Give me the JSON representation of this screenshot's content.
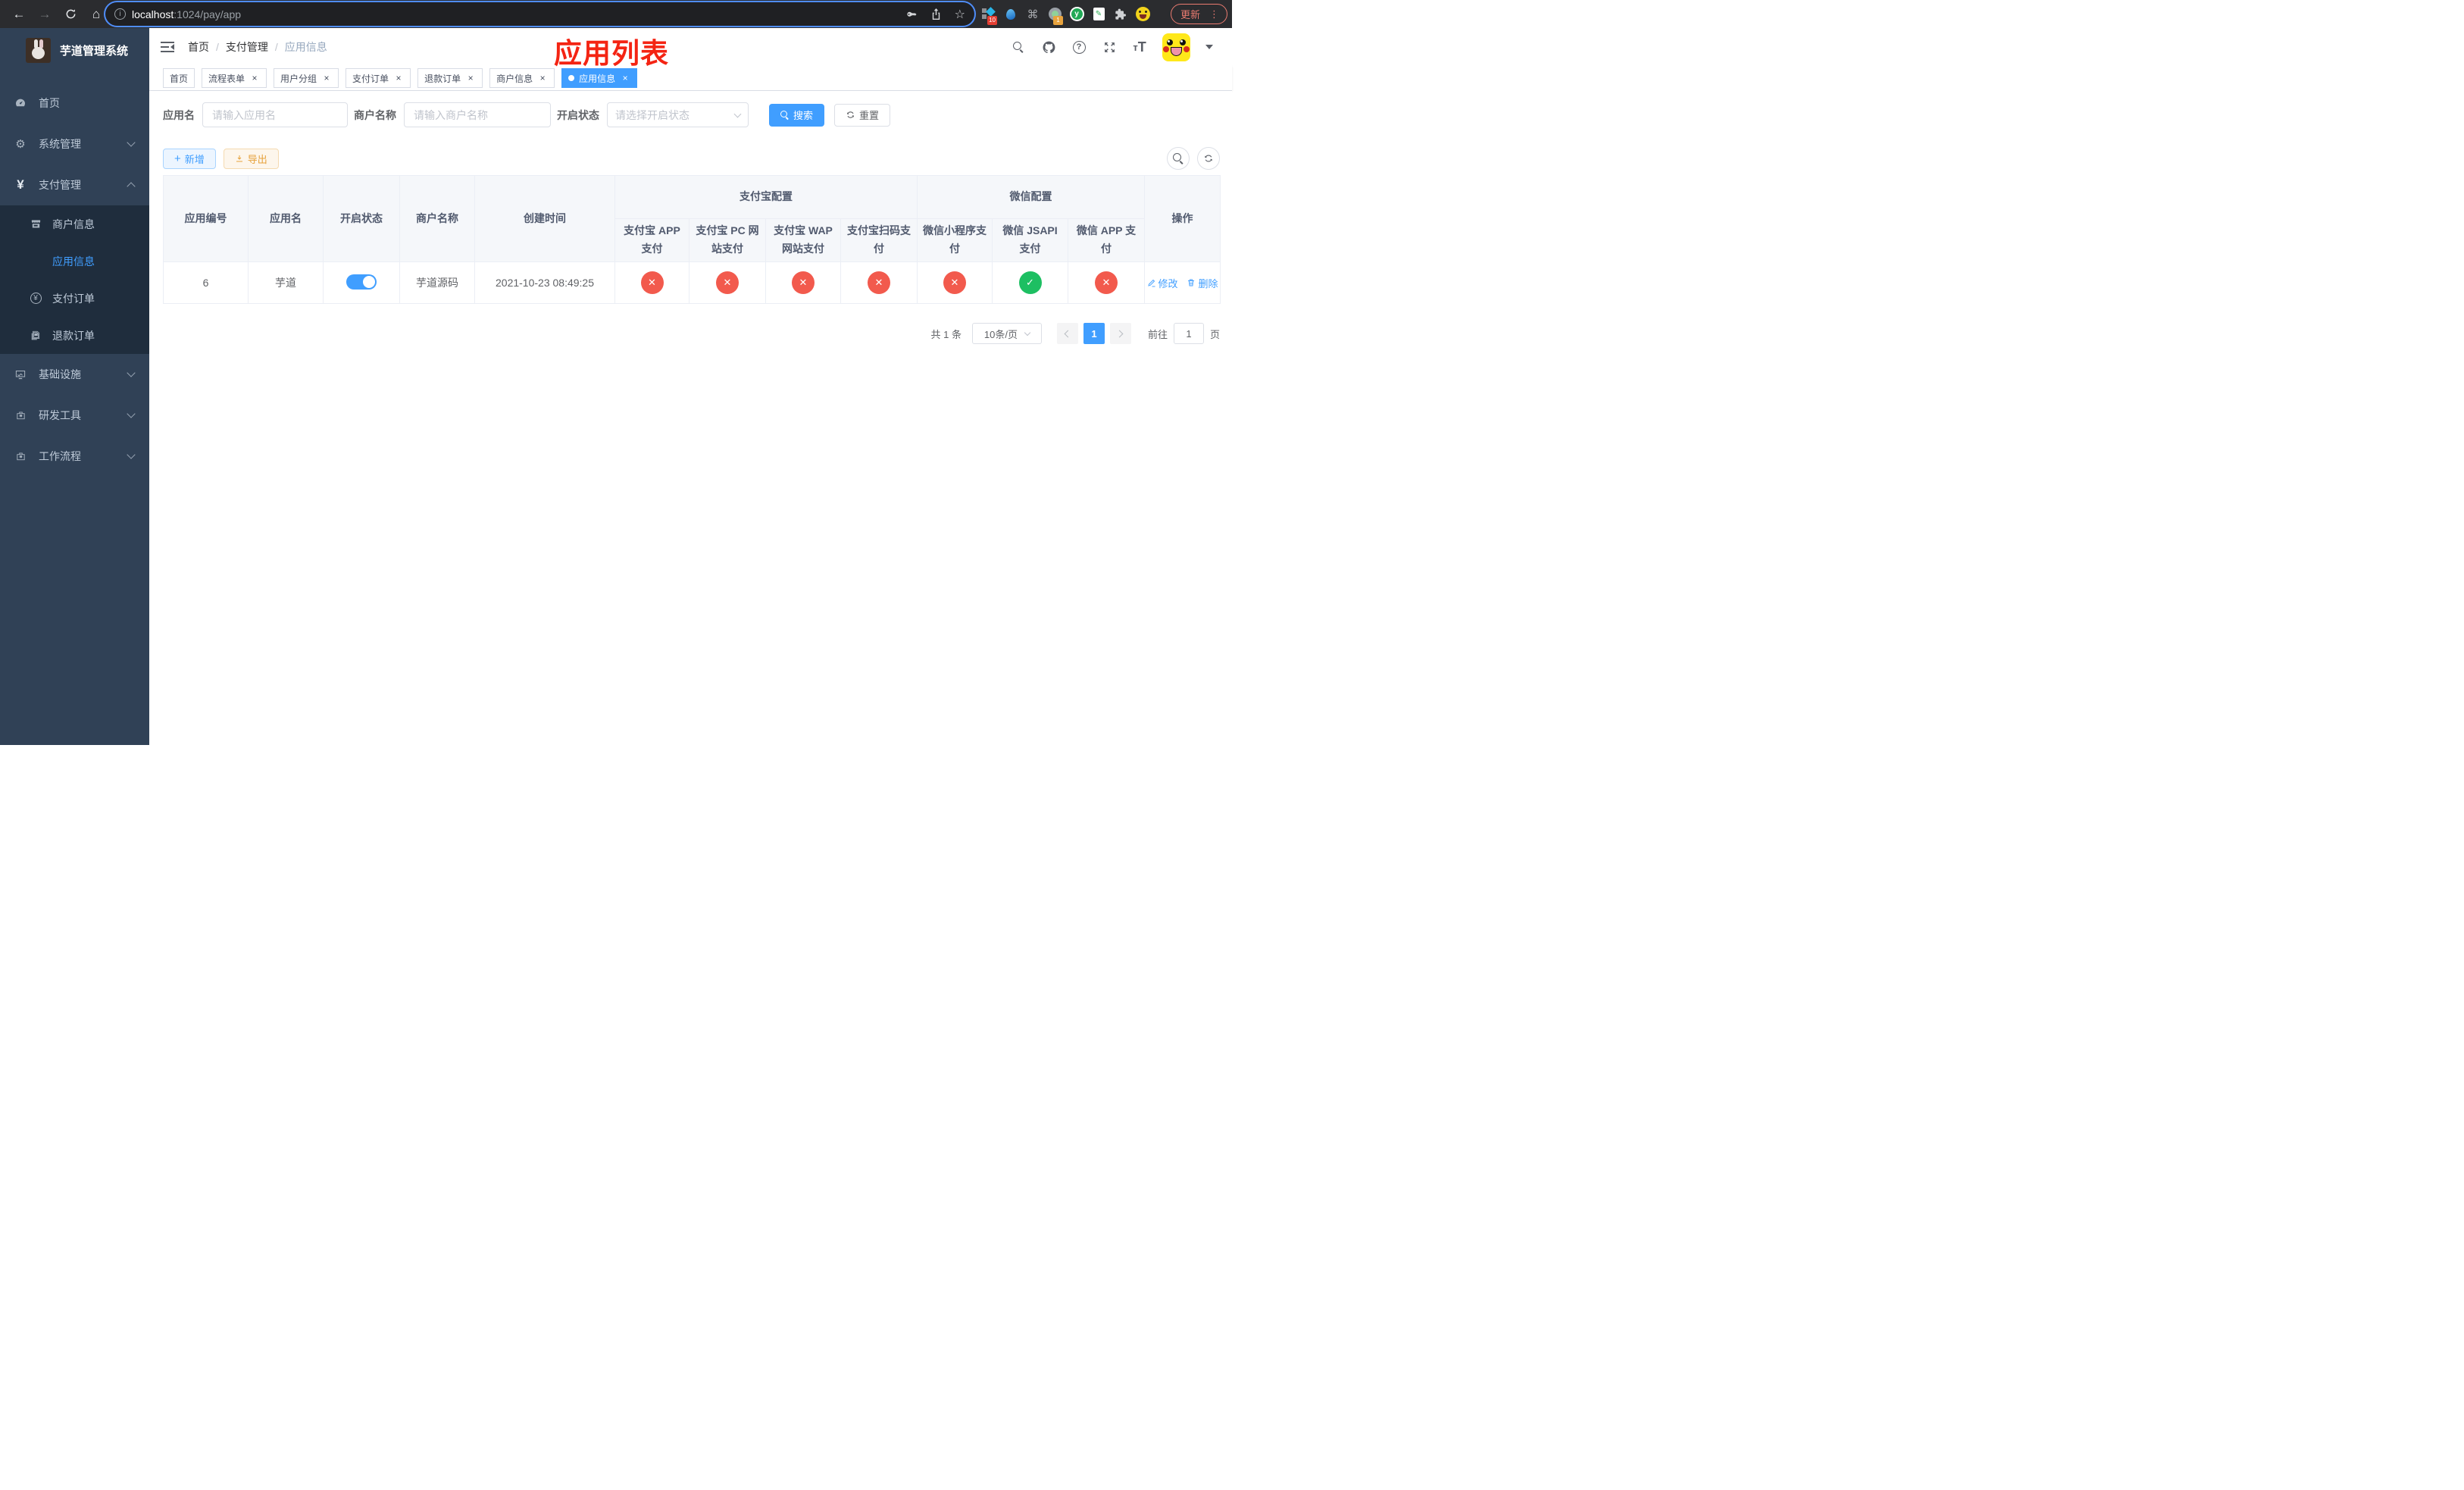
{
  "browser": {
    "url_host": "localhost",
    "url_rest": ":1024/pay/app",
    "update_label": "更新",
    "ext_badge_blue": "10",
    "ext_badge_circle": "1"
  },
  "sidebar": {
    "title": "芋道管理系统",
    "items": [
      {
        "label": "首页"
      },
      {
        "label": "系统管理"
      },
      {
        "label": "支付管理"
      },
      {
        "label": "基础设施"
      },
      {
        "label": "研发工具"
      },
      {
        "label": "工作流程"
      }
    ],
    "pay_children": [
      {
        "label": "商户信息"
      },
      {
        "label": "应用信息"
      },
      {
        "label": "支付订单"
      },
      {
        "label": "退款订单"
      }
    ]
  },
  "header": {
    "breadcrumb": [
      "首页",
      "支付管理",
      "应用信息"
    ],
    "annotation_title": "应用列表"
  },
  "tabs": [
    {
      "label": "首页"
    },
    {
      "label": "流程表单"
    },
    {
      "label": "用户分组"
    },
    {
      "label": "支付订单"
    },
    {
      "label": "退款订单"
    },
    {
      "label": "商户信息"
    },
    {
      "label": "应用信息"
    }
  ],
  "filters": {
    "app_name_label": "应用名",
    "app_name_placeholder": "请输入应用名",
    "merchant_label": "商户名称",
    "merchant_placeholder": "请输入商户名称",
    "status_label": "开启状态",
    "status_placeholder": "请选择开启状态",
    "search_label": "搜索",
    "reset_label": "重置"
  },
  "toolbar": {
    "add_label": "新增",
    "export_label": "导出"
  },
  "table": {
    "columns": {
      "app_id": "应用编号",
      "app_name": "应用名",
      "status": "开启状态",
      "merchant": "商户名称",
      "created": "创建时间",
      "alipay_group": "支付宝配置",
      "wechat_group": "微信配置",
      "alipay_app": "支付宝 APP 支付",
      "alipay_pc": "支付宝 PC 网站支付",
      "alipay_wap": "支付宝 WAP 网站支付",
      "alipay_qr": "支付宝扫码支付",
      "wx_mini": "微信小程序支付",
      "wx_jsapi": "微信 JSAPI 支付",
      "wx_app": "微信 APP 支付",
      "actions": "操作"
    },
    "row": {
      "app_id": "6",
      "app_name": "芋道",
      "merchant": "芋道源码",
      "created": "2021-10-23 08:49:25",
      "edit_label": "修改",
      "delete_label": "删除"
    }
  },
  "pagination": {
    "total": "共 1 条",
    "page_size": "10条/页",
    "current_page": "1",
    "goto_label": "前往",
    "goto_value": "1",
    "unit_label": "页"
  },
  "colors": {
    "accent": "#409eff",
    "danger": "#f25a4d",
    "success": "#1dbf62",
    "annotation": "#f42413",
    "sidebar_bg": "#304156",
    "submenu_bg": "#1f2d3d"
  }
}
